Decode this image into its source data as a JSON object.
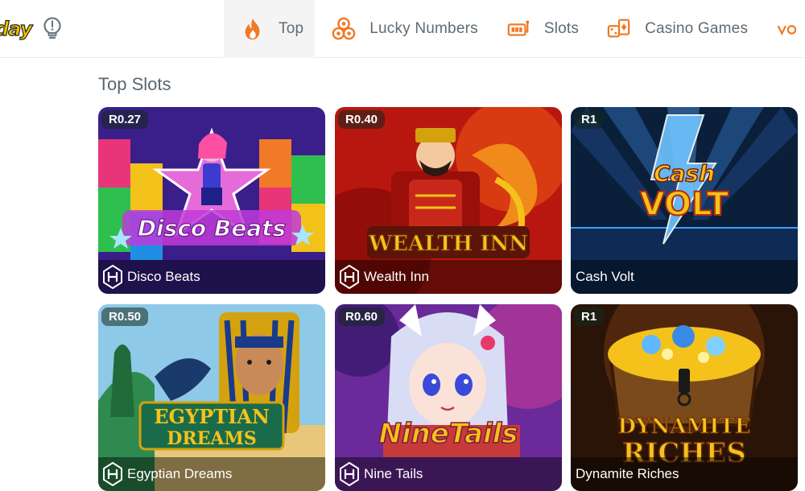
{
  "header": {
    "logo_text": "day",
    "nav": [
      {
        "label": "Top",
        "icon": "fire-icon",
        "active": true
      },
      {
        "label": "Lucky Numbers",
        "icon": "lottery-balls-icon",
        "active": false
      },
      {
        "label": "Slots",
        "icon": "slot-machine-icon",
        "active": false
      },
      {
        "label": "Casino Games",
        "icon": "dice-cards-icon",
        "active": false
      }
    ]
  },
  "section": {
    "title": "Top Slots"
  },
  "games": [
    {
      "name": "Disco Beats",
      "price": "R0.27",
      "has_provider": true,
      "art_title": "Disco Beats"
    },
    {
      "name": "Wealth Inn",
      "price": "R0.40",
      "has_provider": true,
      "art_title": "WEALTH INN"
    },
    {
      "name": "Cash Volt",
      "price": "R1",
      "has_provider": false,
      "art_title_1": "Cash",
      "art_title_2": "VOLT"
    },
    {
      "name": "Egyptian Dreams",
      "price": "R0.50",
      "has_provider": true,
      "art_title_1": "EGYPTIAN",
      "art_title_2": "DREAMS"
    },
    {
      "name": "Nine Tails",
      "price": "R0.60",
      "has_provider": true,
      "art_title": "NineTails"
    },
    {
      "name": "Dynamite Riches",
      "price": "R1",
      "has_provider": false,
      "art_title_1": "DYNAMITE",
      "art_title_2": "RICHES"
    }
  ],
  "colors": {
    "accent": "#f07a28",
    "text": "#5f6b73"
  }
}
